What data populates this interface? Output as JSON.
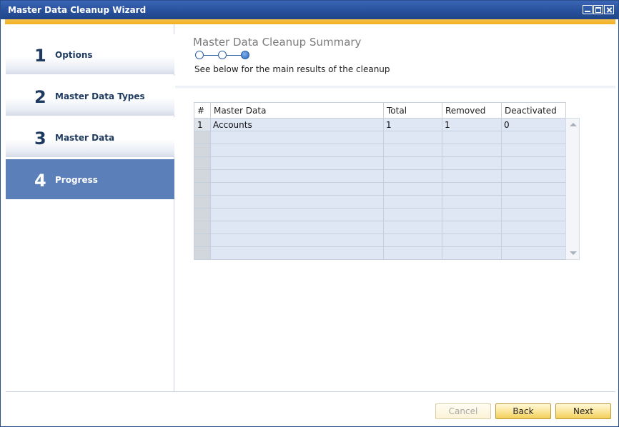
{
  "window": {
    "title": "Master Data Cleanup Wizard"
  },
  "steps": [
    {
      "num": "1",
      "label": "Options",
      "active": false
    },
    {
      "num": "2",
      "label": "Master Data Types",
      "active": false
    },
    {
      "num": "3",
      "label": "Master Data",
      "active": false
    },
    {
      "num": "4",
      "label": "Progress",
      "active": true
    }
  ],
  "page": {
    "title": "Master Data Cleanup Summary",
    "subtitle": "See below for the main results of the cleanup",
    "progress": {
      "total_steps": 3,
      "current_step": 3
    }
  },
  "grid": {
    "columns": [
      "#",
      "Master Data",
      "Total",
      "Removed",
      "Deactivated"
    ],
    "rows": [
      [
        "1",
        "Accounts",
        "1",
        "1",
        "0"
      ],
      [
        "",
        "",
        "",
        "",
        ""
      ],
      [
        "",
        "",
        "",
        "",
        ""
      ],
      [
        "",
        "",
        "",
        "",
        ""
      ],
      [
        "",
        "",
        "",
        "",
        ""
      ],
      [
        "",
        "",
        "",
        "",
        ""
      ],
      [
        "",
        "",
        "",
        "",
        ""
      ],
      [
        "",
        "",
        "",
        "",
        ""
      ],
      [
        "",
        "",
        "",
        "",
        ""
      ],
      [
        "",
        "",
        "",
        "",
        ""
      ],
      [
        "",
        "",
        "",
        "",
        ""
      ]
    ]
  },
  "buttons": {
    "cancel": "Cancel",
    "back": "Back",
    "next": "Next"
  },
  "colors": {
    "accent": "#f2b01e",
    "active_step": "#5a7fb9",
    "titlebar": "#274f9a"
  }
}
